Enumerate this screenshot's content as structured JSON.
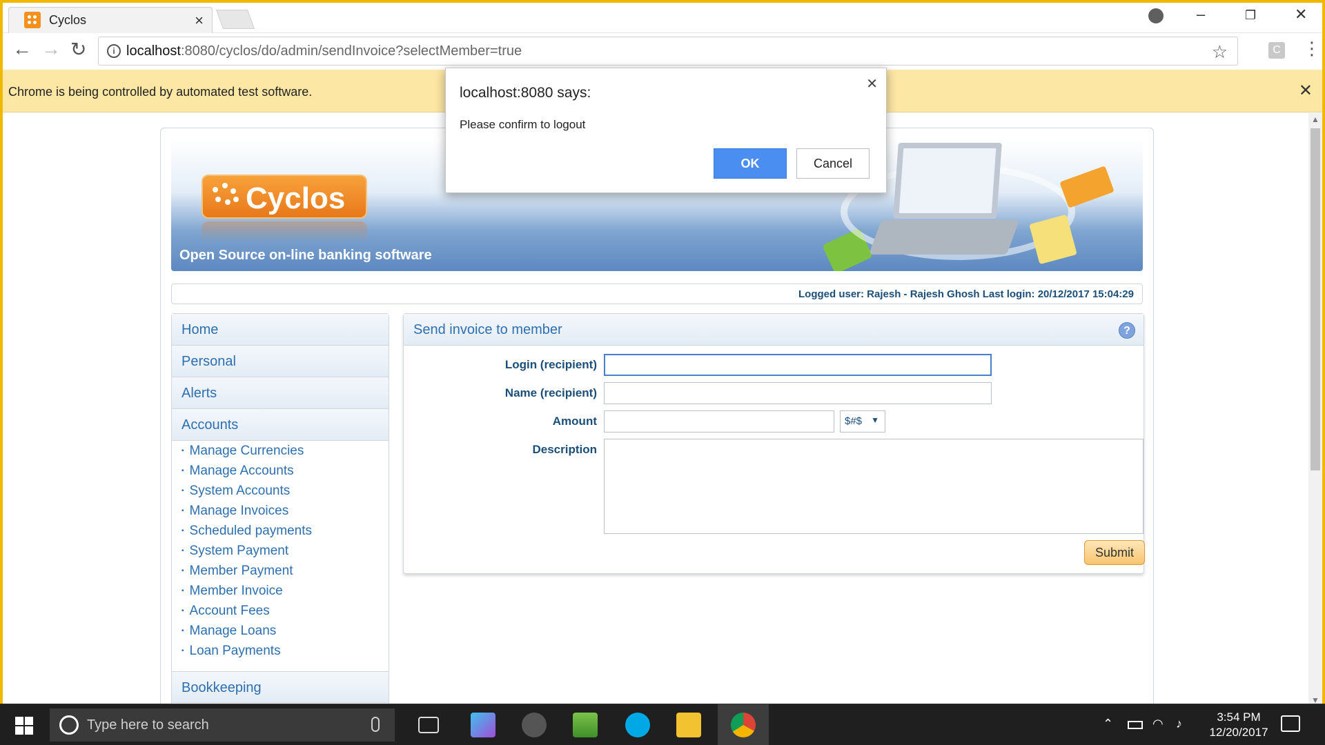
{
  "browser": {
    "tab_title": "Cyclos",
    "url_host": "localhost",
    "url_rest": ":8080/cyclos/do/admin/sendInvoice?selectMember=true",
    "infobar_message": "Chrome is being controlled by automated test software.",
    "ext_label": "C"
  },
  "banner": {
    "logo_text": "Cyclos",
    "tagline": "Open Source on-line banking software"
  },
  "userbar": {
    "info": "Logged user: Rajesh - Rajesh Ghosh   Last login: 20/12/2017 15:04:29"
  },
  "menu": {
    "top_items": [
      "Home",
      "Personal",
      "Alerts",
      "Accounts"
    ],
    "accounts_sub": [
      "Manage Currencies",
      "Manage Accounts",
      "System Accounts",
      "Manage Invoices",
      "Scheduled payments",
      "System Payment",
      "Member Payment",
      "Member Invoice",
      "Account Fees",
      "Manage Loans",
      "Loan Payments"
    ],
    "bottom_item": "Bookkeeping"
  },
  "form": {
    "title": "Send invoice to member",
    "help_label": "?",
    "login_label": "Login (recipient)",
    "name_label": "Name (recipient)",
    "amount_label": "Amount",
    "description_label": "Description",
    "currency_selected": "$#$",
    "submit_label": "Submit"
  },
  "dialog": {
    "title": "localhost:8080 says:",
    "message": "Please confirm to logout",
    "ok_label": "OK",
    "cancel_label": "Cancel"
  },
  "taskbar": {
    "search_placeholder": "Type here to search",
    "time": "3:54 PM",
    "date": "12/20/2017"
  },
  "colors": {
    "accent": "#2d6fb0",
    "label": "#1b4f7a",
    "ok_button": "#4a8ef2",
    "frame": "#f1b800",
    "infobar": "#fde7a4"
  }
}
